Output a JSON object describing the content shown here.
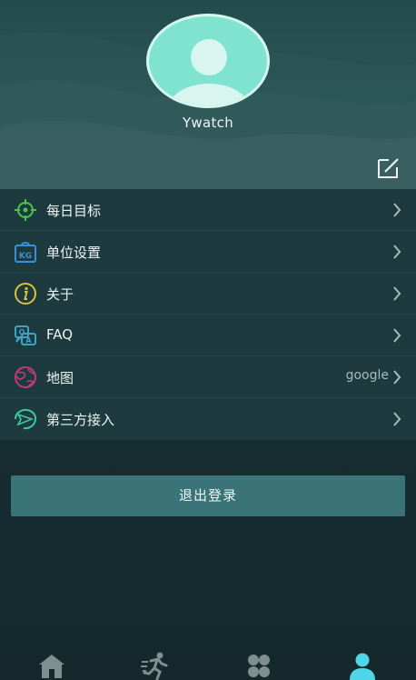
{
  "profile": {
    "username": "Ywatch"
  },
  "menu": {
    "items": [
      {
        "label": "每日目标",
        "icon": "target-icon",
        "value": ""
      },
      {
        "label": "单位设置",
        "icon": "kg-unit-icon",
        "value": ""
      },
      {
        "label": "关于",
        "icon": "info-icon",
        "value": ""
      },
      {
        "label": "FAQ",
        "icon": "faq-icon",
        "value": ""
      },
      {
        "label": "地图",
        "icon": "globe-icon",
        "value": "google"
      },
      {
        "label": "第三方接入",
        "icon": "send-icon",
        "value": ""
      }
    ]
  },
  "logout": {
    "label": "退出登录"
  },
  "bottom_nav": {
    "items": [
      {
        "icon": "home-icon",
        "active": false
      },
      {
        "icon": "running-icon",
        "active": false
      },
      {
        "icon": "apps-icon",
        "active": false
      },
      {
        "icon": "user-icon",
        "active": true
      }
    ]
  },
  "colors": {
    "accent": "#3b7478",
    "avatar": "#7fe3cf",
    "active_nav": "#4fd6e6",
    "target_icon": "#4cc24c",
    "kg_icon": "#3a8fd6",
    "info_icon": "#d9c23a",
    "faq_icon": "#3fa3c8",
    "globe_icon": "#c23a7a",
    "send_icon": "#3fc89a"
  }
}
